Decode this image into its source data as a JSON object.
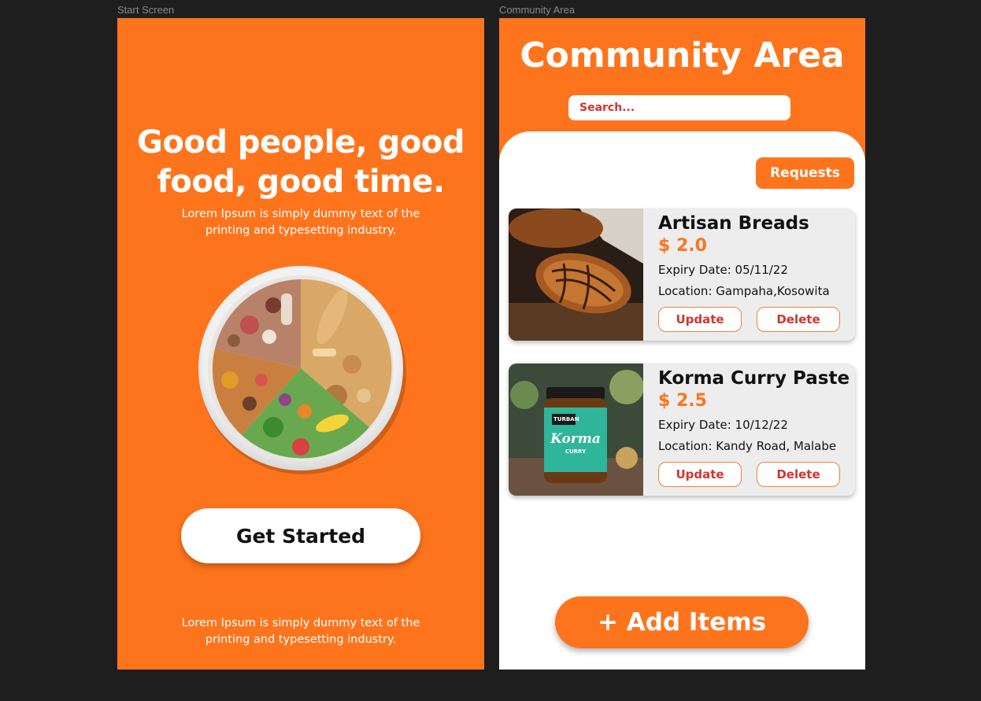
{
  "canvas": {
    "background": "#1e1e1e"
  },
  "frames": {
    "start_label": "Start Screen",
    "community_label": "Community Area"
  },
  "start": {
    "accent": "#fe741d",
    "headline_line1": "Good people, good",
    "headline_line2": "food, good time.",
    "sub1_line1": "Lorem Ipsum is simply dummy text of the",
    "sub1_line2": "printing and typesetting industry.",
    "plate_icon": "food-plate-image",
    "cta": "Get Started",
    "sub2_line1": "Lorem Ipsum is simply dummy text of the",
    "sub2_line2": "printing and typesetting industry."
  },
  "community": {
    "title": "Community Area",
    "search_placeholder": "Search...",
    "requests": "Requests",
    "items": [
      {
        "name": "Artisan Breads",
        "price": "$ 2.0",
        "expiry": "Expiry Date: 05/11/22",
        "location": "Location: Gampaha,Kosowita",
        "image": "bread-photo",
        "update": "Update",
        "delete": "Delete"
      },
      {
        "name": "Korma Curry Paste",
        "price": "$ 2.5",
        "expiry": "Expiry Date: 10/12/22",
        "location": "Location: Kandy Road, Malabe",
        "image": "curry-jar-photo",
        "jar_brand": "TURBAN",
        "jar_label": "Korma",
        "jar_sub": "CURRY",
        "update": "Update",
        "delete": "Delete"
      }
    ],
    "add_items": "+ Add Items"
  },
  "colors": {
    "orange": "#fe741d",
    "red_text": "#d2352e",
    "card_bg": "#ededed"
  }
}
